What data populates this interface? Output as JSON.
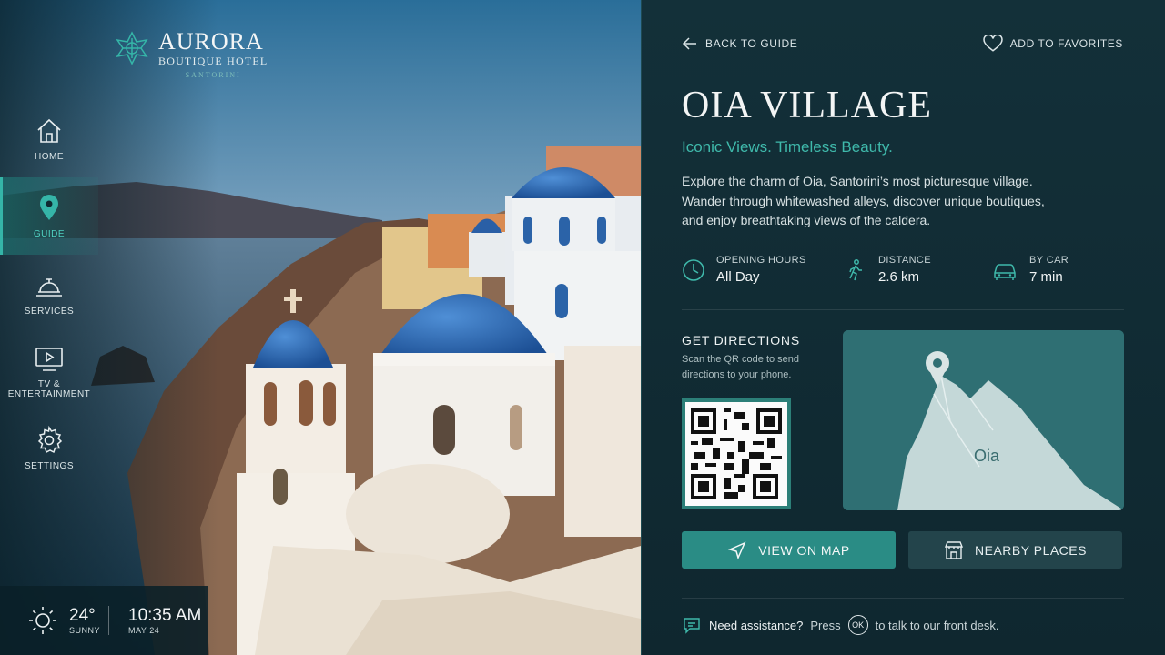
{
  "brand": {
    "name": "AURORA",
    "subtitle": "BOUTIQUE HOTEL",
    "location": "SANTORINI"
  },
  "nav": [
    {
      "label": "HOME",
      "icon": "home-icon",
      "active": false
    },
    {
      "label": "GUIDE",
      "icon": "map-pin-icon",
      "active": true
    },
    {
      "label": "SERVICES",
      "icon": "bell-icon",
      "active": false
    },
    {
      "label": "TV &\nENTERTAINMENT",
      "icon": "tv-icon",
      "active": false
    },
    {
      "label": "SETTINGS",
      "icon": "gear-icon",
      "active": false
    }
  ],
  "weather": {
    "temp": "24°",
    "condition": "SUNNY",
    "time": "10:35 AM",
    "date": "MAY 24",
    "icon": "sun-icon"
  },
  "topbar": {
    "back_label": "BACK TO GUIDE",
    "favorite_label": "ADD TO FAVORITES"
  },
  "place": {
    "title": "OIA VILLAGE",
    "tagline": "Iconic Views. Timeless Beauty.",
    "description": "Explore the charm of Oia, Santorini’s most picturesque village. Wander through whitewashed alleys, discover unique boutiques, and enjoy breathtaking views of the caldera."
  },
  "facts": [
    {
      "label": "OPENING HOURS",
      "value": "All Day",
      "icon": "clock-icon"
    },
    {
      "label": "DISTANCE",
      "value": "2.6 km",
      "icon": "walking-icon"
    },
    {
      "label": "BY CAR",
      "value": "7 min",
      "icon": "car-icon"
    }
  ],
  "directions": {
    "title": "GET DIRECTIONS",
    "subtitle": "Scan the QR code to send directions to your phone."
  },
  "map": {
    "label": "Oia"
  },
  "buttons": {
    "view_map": "VIEW ON MAP",
    "nearby": "NEARBY PLACES"
  },
  "assist": {
    "prefix": "Need assistance?",
    "press": "Press",
    "key": "OK",
    "suffix": "to talk to our front desk."
  },
  "colors": {
    "accent": "#2a8c85",
    "accent_text": "#3fb9ab",
    "panel": "#133039"
  }
}
